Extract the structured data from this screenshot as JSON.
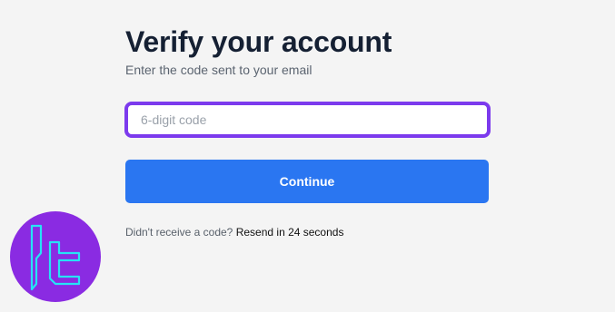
{
  "header": {
    "title": "Verify your account",
    "subtitle": "Enter the code sent to your email"
  },
  "form": {
    "code_input": {
      "placeholder": "6-digit code",
      "value": ""
    },
    "continue_label": "Continue",
    "resend_prompt": "Didn't receive a code?",
    "resend_timer": "Resend in 24 seconds"
  },
  "colors": {
    "accent": "#7c3aed",
    "button": "#2a76f1",
    "logo_circle": "#8a2be2",
    "logo_stroke": "#26e3f5"
  },
  "icons": {
    "logo": "tc-logo-icon"
  }
}
